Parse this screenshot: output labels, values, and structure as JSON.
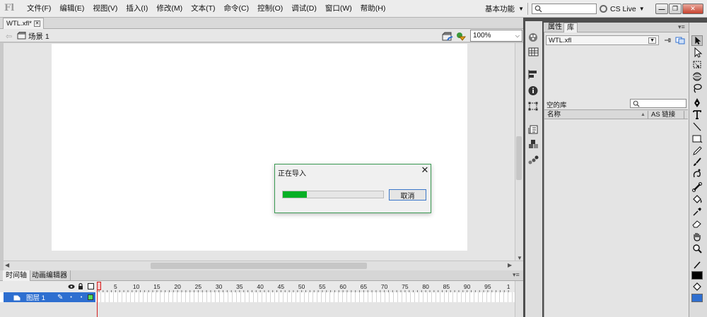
{
  "app": {
    "logo": "Fl"
  },
  "menus": [
    "文件(F)",
    "编辑(E)",
    "视图(V)",
    "插入(I)",
    "修改(M)",
    "文本(T)",
    "命令(C)",
    "控制(O)",
    "调试(D)",
    "窗口(W)",
    "帮助(H)"
  ],
  "toolbar": {
    "workspace_label": "基本功能",
    "search_placeholder": "",
    "cs_live_label": "CS Live"
  },
  "document": {
    "tab_name": "WTL.xfl*",
    "scene_name": "场景 1",
    "zoom": "100%"
  },
  "timeline": {
    "tabs": [
      "时间轴",
      "动画编辑器"
    ],
    "frame_numbers": [
      "5",
      "10",
      "15",
      "20",
      "25",
      "30",
      "35",
      "40",
      "45",
      "50",
      "55",
      "60",
      "65",
      "70",
      "75",
      "80",
      "85",
      "90",
      "95",
      "1"
    ],
    "layer_name": "图层 1"
  },
  "panel": {
    "tabs": [
      "属性",
      "库"
    ],
    "library_file": "WTL.xfl",
    "empty_library_label": "空的库",
    "column_name": "名称",
    "column_as_linkage": "AS 链接"
  },
  "dialog": {
    "title": "正在导入",
    "cancel_label": "取消",
    "progress": 0.24
  },
  "colors": {
    "progress_fill": "#06b025",
    "layer_highlight": "#2e6fd0",
    "playhead": "#d21f1f",
    "dialog_border": "#3a9a52"
  },
  "icons": {
    "strip": [
      "paint-brush-icon",
      "swatches-icon",
      "align-icon",
      "info-icon",
      "transform-icon",
      "code-snippets-icon",
      "components-icon",
      "motion-presets-icon"
    ],
    "tools": [
      "selection-tool-icon",
      "subselection-tool-icon",
      "free-transform-tool-icon",
      "3d-rotation-tool-icon",
      "lasso-tool-icon",
      "pen-tool-icon",
      "text-tool-icon",
      "line-tool-icon",
      "rectangle-tool-icon",
      "pencil-tool-icon",
      "brush-tool-icon",
      "deco-tool-icon",
      "bone-tool-icon",
      "paint-bucket-tool-icon",
      "eyedropper-tool-icon",
      "eraser-tool-icon",
      "hand-tool-icon",
      "zoom-tool-icon",
      "stroke-color-icon",
      "fill-color-icon"
    ]
  }
}
